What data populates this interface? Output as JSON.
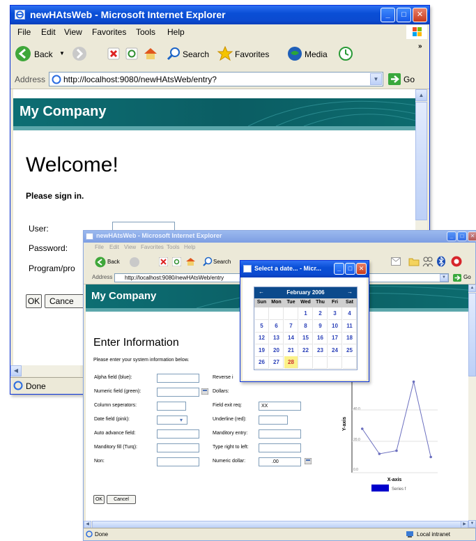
{
  "window1": {
    "title": "newHAtsWeb - Microsoft Internet Explorer",
    "menu": [
      "File",
      "Edit",
      "View",
      "Favorites",
      "Tools",
      "Help"
    ],
    "toolbar": {
      "back": "Back",
      "search": "Search",
      "favorites": "Favorites",
      "media": "Media"
    },
    "address": {
      "label": "Address",
      "url": "http://localhost:9080/newHAtsWeb/entry?",
      "go": "Go"
    },
    "banner": "My Company",
    "heading": "Welcome!",
    "subheading": "Please sign in.",
    "labels": {
      "user": "User:",
      "password": "Password:",
      "program": "Program/pro"
    },
    "buttons": {
      "ok": "OK",
      "cancel": "Cance"
    },
    "status": "Done"
  },
  "window2": {
    "title": "newHAtsWeb - Microsoft Internet Explorer",
    "menu": [
      "File",
      "Edit",
      "View",
      "Favorites",
      "Tools",
      "Help"
    ],
    "toolbar": {
      "back": "Back",
      "search": "Search"
    },
    "address": {
      "label": "Address",
      "url": "http://localhost:9080/newHAtsWeb/entry",
      "go": "Go"
    },
    "banner": "My Company",
    "heading": "Enter Information",
    "intro": "Please enter your system information below.",
    "left_fields": [
      {
        "label": "Alpha field (blue):",
        "value": ""
      },
      {
        "label": "Numeric field (green):",
        "value": ""
      },
      {
        "label": "Column seperators:",
        "value": ""
      },
      {
        "label": "Date field (pink):",
        "value": ""
      },
      {
        "label": "Auto advance field:",
        "value": ""
      },
      {
        "label": "Manditory fill (Turq):",
        "value": ""
      },
      {
        "label": "Non:",
        "value": ""
      }
    ],
    "right_fields": [
      {
        "label": "Reverse i",
        "value": ""
      },
      {
        "label": "Dollars:",
        "value": ""
      },
      {
        "label": "Field exit req:",
        "value": "XX"
      },
      {
        "label": "Underline (red):",
        "value": ""
      },
      {
        "label": "Manditory entry:",
        "value": ""
      },
      {
        "label": "Type right to left:",
        "value": ""
      },
      {
        "label": "Numeric dollar:",
        "value": ".00"
      }
    ],
    "buttons": {
      "ok": "OK",
      "cancel": "Cancel"
    },
    "status": "Done",
    "zone": "Local intranet"
  },
  "chart_data": {
    "type": "line",
    "x": [
      1,
      2,
      3,
      4,
      5
    ],
    "series": [
      {
        "name": "Series f",
        "values": [
          28,
          12,
          14,
          58,
          10
        ]
      }
    ],
    "xlabel": "X-axis",
    "ylabel": "Y-axis",
    "yticks": [
      "40.0",
      "20.0",
      "0.0"
    ],
    "ylim": [
      0,
      60
    ],
    "legend": "bottom"
  },
  "calendar": {
    "title": "Select a date... - Micr...",
    "month": "February 2006",
    "prev": "←",
    "next": "→",
    "weekdays": [
      "Sun",
      "Mon",
      "Tue",
      "Wed",
      "Thu",
      "Fri",
      "Sat"
    ],
    "days": [
      [
        "",
        "",
        "",
        "1",
        "2",
        "3",
        "4"
      ],
      [
        "5",
        "6",
        "7",
        "8",
        "9",
        "10",
        "11"
      ],
      [
        "12",
        "13",
        "14",
        "15",
        "16",
        "17",
        "18"
      ],
      [
        "19",
        "20",
        "21",
        "22",
        "23",
        "24",
        "25"
      ],
      [
        "26",
        "27",
        "28",
        "",
        "",
        "",
        ""
      ]
    ],
    "selected": "28"
  },
  "colors": {
    "banner": "#0b5d63",
    "titlebar": "#0a4fd6",
    "chart_line": "#6b6fbf",
    "legend": "#0000cc",
    "calendar_header": "#0c4a8c",
    "selected_day": "#fbf28a"
  }
}
